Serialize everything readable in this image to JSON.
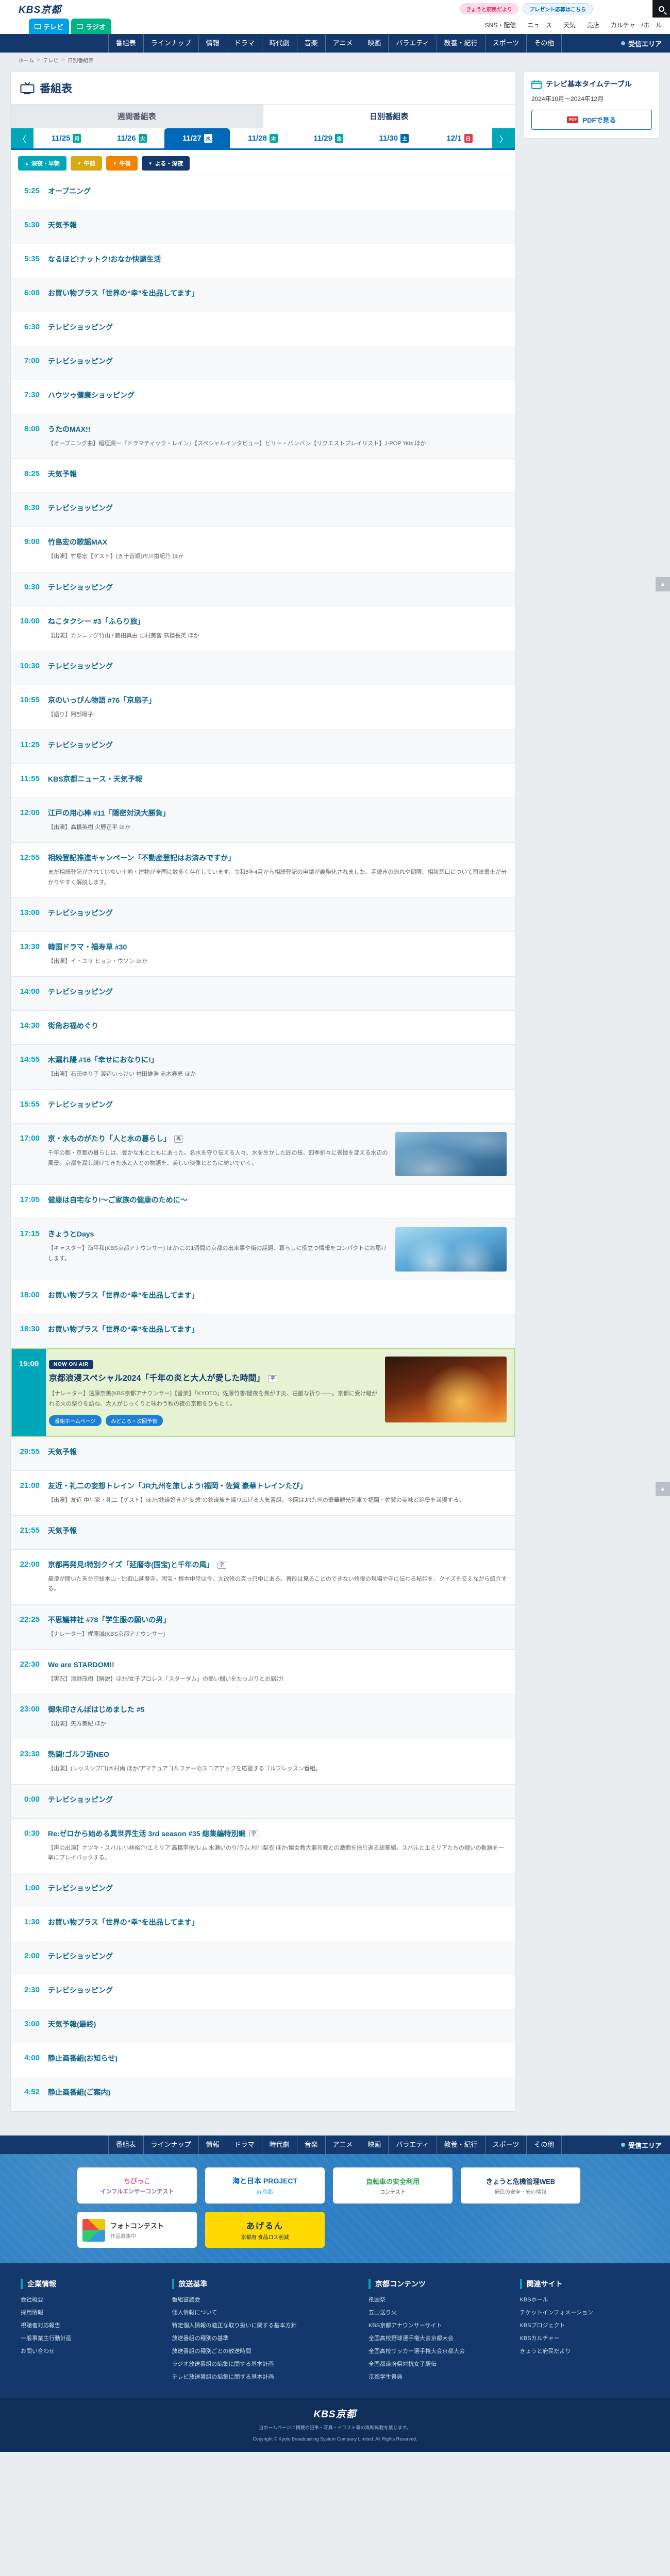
{
  "topbar": {
    "banner_pink": "きょうと府民だより",
    "banner_blue": "プレゼント応募はこちら"
  },
  "header": {
    "logo": "KBS京都",
    "tab_tv": "テレビ",
    "tab_radio": "ラジオ",
    "links": [
      "SNS・配信",
      "ニュース",
      "天気",
      "売店",
      "カルチャー/ホール"
    ]
  },
  "nav": {
    "items": [
      "番組表",
      "ラインナップ",
      "情報",
      "ドラマ",
      "時代劇",
      "音楽",
      "アニメ",
      "映画",
      "バラエティ",
      "教養・紀行",
      "スポーツ",
      "その他"
    ],
    "right_item": "受信エリア"
  },
  "breadcrumb": {
    "items": [
      "ホーム",
      "テレビ",
      "日別番組表"
    ]
  },
  "page": {
    "title": "番組表"
  },
  "view_tabs": {
    "weekly": "週間番組表",
    "daily": "日別番組表"
  },
  "date_nav": {
    "prev": "〈",
    "next": "〉",
    "dates": [
      {
        "date": "11/25",
        "day": "月",
        "type": "weekday",
        "selected": false
      },
      {
        "date": "11/26",
        "day": "火",
        "type": "weekday",
        "selected": false
      },
      {
        "date": "11/27",
        "day": "水",
        "type": "weekday",
        "selected": true
      },
      {
        "date": "11/28",
        "day": "木",
        "type": "weekday",
        "selected": false
      },
      {
        "date": "11/29",
        "day": "金",
        "type": "weekday",
        "selected": false
      },
      {
        "date": "11/30",
        "day": "土",
        "type": "saturday",
        "selected": false
      },
      {
        "date": "12/1",
        "day": "日",
        "type": "sunday",
        "selected": false
      }
    ]
  },
  "sidebar": {
    "title": "テレビ基本タイムテーブル",
    "period": "2024年10月〜2024年12月",
    "pdf_button": "PDFで見る",
    "pdf_icon": "PDF"
  },
  "jump_buttons": [
    {
      "label": "深夜・早朝",
      "arrow": "▲",
      "color": "teal"
    },
    {
      "label": "午前",
      "arrow": "▼",
      "color": "yellow"
    },
    {
      "label": "午後",
      "arrow": "▼",
      "color": "orange"
    },
    {
      "label": "よる・深夜",
      "arrow": "▼",
      "color": "navy"
    }
  ],
  "page_top": "▲",
  "programs": [
    {
      "time": "5:25",
      "title": "オープニング"
    },
    {
      "time": "5:30",
      "title": "天気予報"
    },
    {
      "time": "5:35",
      "title": "なるほど!ナットク!おなか快調生活"
    },
    {
      "time": "6:00",
      "title": "お買い物プラス「世界の“幸”を出品してます」"
    },
    {
      "time": "6:30",
      "title": "テレビショッピング"
    },
    {
      "time": "7:00",
      "title": "テレビショッピング"
    },
    {
      "time": "7:30",
      "title": "ハウツゥ健康ショッピング"
    },
    {
      "time": "8:00",
      "title": "うたのMAX!!",
      "desc": "【オープニング曲】稲垣潤一『ドラマティック・レイン』【スペシャルインタビュー】ビリー・バンバン【リクエストプレイリスト】J-POP '80s ほか"
    },
    {
      "time": "8:25",
      "title": "天気予報"
    },
    {
      "time": "8:30",
      "title": "テレビショッピング"
    },
    {
      "time": "9:00",
      "title": "竹島宏の歌謡MAX",
      "desc": "【出演】竹島宏【ゲスト】(五十音順)市川由紀乃 ほか"
    },
    {
      "time": "9:30",
      "title": "テレビショッピング"
    },
    {
      "time": "10:00",
      "title": "ねこタクシー #3「ふらり旅」",
      "desc": "【出演】カンニング竹山 / 鶴田真由 山村美智 高橋長英 ほか"
    },
    {
      "time": "10:30",
      "title": "テレビショッピング"
    },
    {
      "time": "10:55",
      "title": "京のいっぴん物語 #76「京扇子」",
      "desc": "【語り】阿部陽子"
    },
    {
      "time": "11:25",
      "title": "テレビショッピング"
    },
    {
      "time": "11:55",
      "title": "KBS京都ニュース・天気予報"
    },
    {
      "time": "12:00",
      "title": "江戸の用心棒 #11「隠密対決大勝負」",
      "desc": "【出演】高橋英樹 火野正平 ほか"
    },
    {
      "time": "12:55",
      "title": "相続登記推進キャンペーン「不動産登記はお済みですか」",
      "desc": "まだ相続登記がされていない土地・建物が全国に数多く存在しています。令和6年4月から相続登記の申請が義務化されました。手続きの流れや期限、相談窓口について司法書士が分かりやすく解説します。"
    },
    {
      "time": "13:00",
      "title": "テレビショッピング"
    },
    {
      "time": "13:30",
      "title": "韓国ドラマ・福寿草 #30",
      "desc": "【出演】イ・ユリ ヒョン・ウソン ほか"
    },
    {
      "time": "14:00",
      "title": "テレビショッピング"
    },
    {
      "time": "14:30",
      "title": "街角お福めぐり"
    },
    {
      "time": "14:55",
      "title": "木漏れ陽 #16「幸せにおなりに!」",
      "desc": "【出演】石田ゆり子 渡辺いっけい 村田雄浩 赤木春恵 ほか"
    },
    {
      "time": "15:55",
      "title": "テレビショッピング"
    },
    {
      "time": "17:00",
      "title": "京・水ものがたり「人と水の暮らし」",
      "flags": [
        "再"
      ],
      "thumb": "water",
      "desc": "千年の都・京都の暮らしは、豊かな水とともにあった。名水を守り伝える人々、水を生かした匠の技、四季折々に表情を変える水辺の風景。京都を潤し続けてきた水と人との物語を、美しい映像とともに紡いでいく。"
    },
    {
      "time": "17:05",
      "title": "健康は自宅なり!〜ご家族の健康のために〜"
    },
    {
      "time": "17:15",
      "title": "きょうとDays",
      "thumb": "days",
      "desc": "【キャスター】海平和(KBS京都アナウンサー) ほか/この1週間の京都の出来事や街の話題、暮らしに役立つ情報をコンパクトにお届けします。"
    },
    {
      "time": "18:00",
      "title": "お買い物プラス「世界の“幸”を出品してます」"
    },
    {
      "time": "18:30",
      "title": "お買い物プラス「世界の“幸”を出品してます」"
    },
    {
      "time": "19:00",
      "highlight": true,
      "badge": "NOW ON AIR",
      "flags": [
        "字"
      ],
      "thumb": "fire",
      "title": "京都浪漫スペシャル2024「千年の炎と大人が愛した時間」",
      "desc": "【ナレーター】遠藤奈美(KBS京都アナウンサー)【音楽】「KYOTO」佐藤竹善/闇夜を焦がす炎、荘厳な祈り——。京都に受け継がれる火の祭りを訪ね、大人がじっくりと味わう秋の夜の京都をひもとく。",
      "tags": [
        "番組ホームページ",
        "みどころ・次回予告"
      ]
    },
    {
      "time": "20:55",
      "title": "天気予報"
    },
    {
      "time": "21:00",
      "title": "友近・礼二の妄想トレイン「JR九州を旅しよう!福岡・佐賀 豪華トレインたび」",
      "desc": "【出演】友近 中川家・礼二【ゲスト】ほか/鉄道好きが“妄想”の鉄道旅を繰り広げる人気番組。今回はJR九州の豪華観光列車で福岡・佐賀の美味と絶景を満喫する。"
    },
    {
      "time": "21:55",
      "title": "天気予報"
    },
    {
      "time": "22:00",
      "title": "京都再発見!特別クイズ「延暦寺(国宝)と千年の風」",
      "flags": [
        "字"
      ],
      "desc": "最澄が開いた天台宗総本山・比叡山延暦寺。国宝・根本中堂は今、大改修の真っ只中にある。普段は見ることのできない修復の現場や寺に伝わる秘話を、クイズを交えながら紹介する。"
    },
    {
      "time": "22:25",
      "title": "不思議神社 #78「学生服の願いの男」",
      "desc": "【ナレーター】梶原誠(KBS京都アナウンサー)"
    },
    {
      "time": "22:30",
      "title": "We are STARDOM!!",
      "desc": "【実況】清野茂樹【解説】ほか/女子プロレス「スターダム」の熱い闘いをたっぷりとお届け!"
    },
    {
      "time": "23:00",
      "title": "御朱印さんぽはじめました #5",
      "desc": "【出演】矢方美紀 ほか"
    },
    {
      "time": "23:30",
      "title": "熱闘!ゴルフ道NEO",
      "desc": "【出演】(レッスンプロ)木村尚 ほか/アマチュアゴルファーのスコアアップを応援するゴルフレッスン番組。"
    },
    {
      "time": "0:00",
      "title": "テレビショッピング"
    },
    {
      "time": "0:30",
      "title": "Re:ゼロから始める異世界生活 3rd season #35 総集編特別編",
      "flags": [
        "字"
      ],
      "desc": "【声の出演】ナツキ・スバル:小林裕介/エミリア:高橋李依/レム:水瀬いのり/ラム:村川梨衣 ほか/魔女教大罪司教との激闘を振り返る総集編。スバルとエミリアたちの戦いの軌跡を一挙にプレイバックする。"
    },
    {
      "time": "1:00",
      "title": "テレビショッピング"
    },
    {
      "time": "1:30",
      "title": "お買い物プラス「世界の“幸”を出品してます」"
    },
    {
      "time": "2:00",
      "title": "テレビショッピング"
    },
    {
      "time": "2:30",
      "title": "テレビショッピング"
    },
    {
      "time": "3:00",
      "title": "天気予報(最終)"
    },
    {
      "time": "4:00",
      "title": "静止画番組(お知らせ)"
    },
    {
      "time": "4:52",
      "title": "静止画番組(ご案内)"
    }
  ],
  "banners": [
    {
      "style": "pink",
      "line1": "ちびっこ",
      "line2": "インフルエンサーコンテスト"
    },
    {
      "style": "umi",
      "line1": "海と日本 PROJECT",
      "line2": "in 京都"
    },
    {
      "style": "green",
      "line1": "自転車の安全利用",
      "line2": "コンテスト"
    },
    {
      "style": "navy",
      "line1": "きょうと危機管理WEB",
      "line2": "府民の安全・安心情報"
    },
    {
      "style": "photo",
      "line1": "フォトコンテスト",
      "line2": "作品募集中"
    },
    {
      "style": "yellow",
      "line1": "あげるん",
      "line2": "京都府 食品ロス削減"
    }
  ],
  "footer": {
    "columns": [
      {
        "title": "企業情報",
        "items": [
          "会社概要",
          "採用情報",
          "視聴者対応報告",
          "一般事業主行動計画",
          "お問い合わせ"
        ]
      },
      {
        "title": "放送基準",
        "items": [
          "番組審議会",
          "個人情報について",
          "特定個人情報の適正な取り扱いに関する基本方針",
          "放送番組の種別の基準",
          "放送番組の種別ごとの放送時間",
          "ラジオ放送番組の編集に関する基本計画",
          "テレビ放送番組の編集に関する基本計画"
        ]
      },
      {
        "title": "京都コンテンツ",
        "items": [
          "祇園祭",
          "五山送り火",
          "KBS京都アナウンサーサイト",
          "全国高校野球選手権大会京都大会",
          "全国高校サッカー選手権大会京都大会",
          "全国都道府県対抗女子駅伝",
          "京都学生祭典"
        ]
      },
      {
        "title": "関連サイト",
        "items": [
          "KBSホール",
          "チケットインフォメーション",
          "KBSプロジェクト",
          "KBSカルチャー",
          "きょうと府民だより"
        ]
      }
    ],
    "logo": "KBS京都",
    "copyright1": "当ホームページに掲載の記事・写真・イラスト等の無断転載を禁じます。",
    "copyright2": "Copyright © Kyoto Broadcasting System Company Limited. All Rights Reserved."
  }
}
